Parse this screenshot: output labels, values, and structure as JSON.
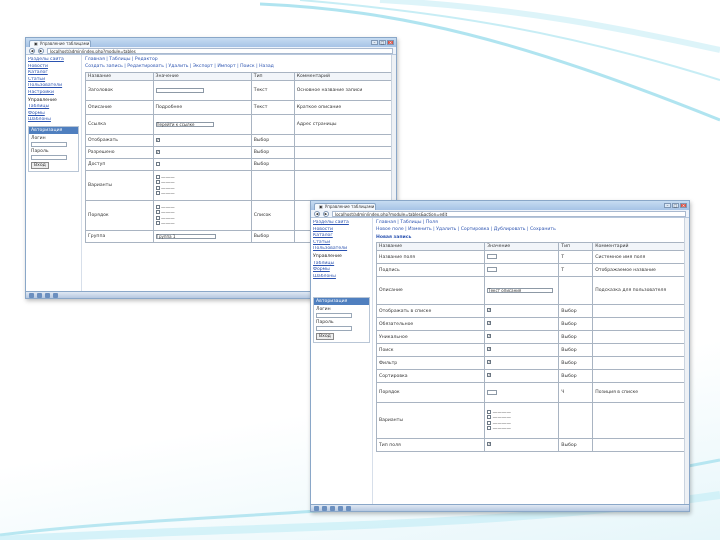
{
  "slide": {
    "accent": "#7fd3e6"
  },
  "window1": {
    "tab_title": "Управление таблицами",
    "url": "localhost/admin/index.php?module=tables",
    "breadcrumb": "Главная | Таблицы | Редактор",
    "menu": "Создать запись | Редактировать | Удалить | Экспорт | Импорт | Поиск | Назад",
    "table_headers": [
      "Название",
      "Значение",
      "Тип",
      "Комментарий"
    ],
    "rows": [
      {
        "name": "Заголовок",
        "value": "",
        "type": "Текст",
        "comment": "Основное название записи"
      },
      {
        "name": "Описание",
        "value": "Подробнее",
        "type": "Текст",
        "comment": "Краткое описание"
      },
      {
        "name": "Ссылка",
        "value": "Перейти к ссылке",
        "type": "",
        "comment": "Адрес страницы"
      },
      {
        "name": "Отображать",
        "value": "",
        "type": "Выбор",
        "comment": ""
      },
      {
        "name": "Разрешено",
        "value": "",
        "type": "Выбор",
        "comment": ""
      },
      {
        "name": "Доступ",
        "value": "",
        "type": "Выбор",
        "comment": ""
      },
      {
        "name": "Варианты",
        "value": "",
        "type": "",
        "comment": ""
      },
      {
        "name": "Порядок",
        "value": "",
        "type": "Список",
        "comment": ""
      },
      {
        "name": "Группа",
        "value": "Группа 1",
        "type": "Выбор",
        "comment": ""
      }
    ],
    "nav_links": [
      "Разделы сайта",
      "Новости",
      "Каталог",
      "Статьи",
      "Пользователи",
      "Настройки"
    ],
    "nav_head": "Управление",
    "nav_links2": [
      "Таблицы",
      "Формы",
      "Шаблоны"
    ],
    "box_title": "Авторизация",
    "login_label": "Логин",
    "password_label": "Пароль",
    "login_button": "Вход"
  },
  "window2": {
    "tab_title": "Управление таблицами",
    "url": "localhost/admin/index.php?module=tables&action=edit",
    "breadcrumb": "Главная | Таблицы | Поля",
    "menu": "Новое поле | Изменить | Удалить | Сортировка | Дублировать | Сохранить",
    "heading": "Новая запись",
    "table_headers": [
      "Название",
      "Значение",
      "Тип",
      "Комментарий"
    ],
    "rows": [
      {
        "name": "Название поля",
        "value": "",
        "type": "Т",
        "comment": "Системное имя поля"
      },
      {
        "name": "Подпись",
        "value": "",
        "type": "Т",
        "comment": "Отображаемое название"
      },
      {
        "name": "Описание",
        "value": "Текст описания",
        "type": "",
        "comment": "Подсказка для пользователя"
      },
      {
        "name": "Отображать в списке",
        "value": "",
        "type": "Выбор",
        "comment": ""
      },
      {
        "name": "Обязательное",
        "value": "",
        "type": "Выбор",
        "comment": ""
      },
      {
        "name": "Уникальное",
        "value": "",
        "type": "Выбор",
        "comment": ""
      },
      {
        "name": "Поиск",
        "value": "",
        "type": "Выбор",
        "comment": ""
      },
      {
        "name": "Фильтр",
        "value": "",
        "type": "Выбор",
        "comment": ""
      },
      {
        "name": "Сортировка",
        "value": "",
        "type": "Выбор",
        "comment": ""
      },
      {
        "name": "Порядок",
        "value": "",
        "type": "Ч",
        "comment": "Позиция в списке"
      },
      {
        "name": "Варианты",
        "value": "",
        "type": "",
        "comment": ""
      },
      {
        "name": "Тип поля",
        "value": "",
        "type": "Выбор",
        "comment": ""
      }
    ],
    "nav_links": [
      "Разделы сайта",
      "Новости",
      "Каталог",
      "Статьи",
      "Пользователи"
    ],
    "nav_head": "Управление",
    "nav_links2": [
      "Таблицы",
      "Формы",
      "Шаблоны"
    ],
    "box_title": "Авторизация",
    "login_label": "Логин",
    "password_label": "Пароль",
    "login_button": "Вход"
  }
}
